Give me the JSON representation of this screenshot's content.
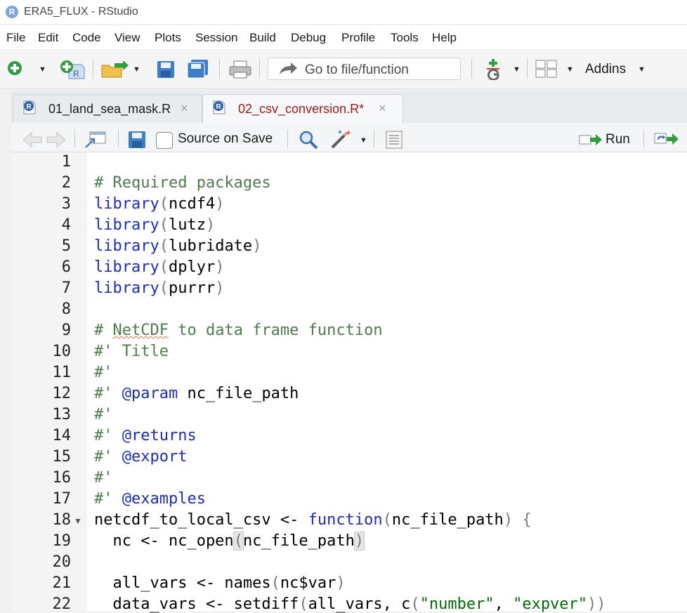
{
  "window": {
    "title": "ERA5_FLUX - RStudio",
    "logo_letter": "R"
  },
  "menu": [
    "File",
    "Edit",
    "Code",
    "View",
    "Plots",
    "Session",
    "Build",
    "Debug",
    "Profile",
    "Tools",
    "Help"
  ],
  "toolbar": {
    "goto_placeholder": "Go to file/function",
    "addins_label": "Addins"
  },
  "tabs": [
    {
      "label": "01_land_sea_mask.R",
      "active": false,
      "close": "×"
    },
    {
      "label": "02_csv_conversion.R*",
      "active": true,
      "close": "×"
    }
  ],
  "editor_toolbar": {
    "source_on_save_label": "Source on Save",
    "source_on_save_checked": false,
    "run_label": "Run"
  },
  "editor": {
    "line_numbers": [
      "1",
      "2",
      "3",
      "4",
      "5",
      "6",
      "7",
      "8",
      "9",
      "10",
      "11",
      "12",
      "13",
      "14",
      "15",
      "16",
      "17",
      "18",
      "19",
      "20",
      "21",
      "22"
    ],
    "lines": [
      "",
      "# Required packages",
      "library(ncdf4)",
      "library(lutz)",
      "library(lubridate)",
      "library(dplyr)",
      "library(purrr)",
      "",
      "# NetCDF to data frame function",
      "#' Title",
      "#'",
      "#' @param nc_file_path",
      "#'",
      "#' @returns",
      "#' @export",
      "#'",
      "#' @examples",
      "netcdf_to_local_csv <- function(nc_file_path) {",
      "  nc <- nc_open(nc_file_path)",
      "",
      "  all_vars <- names(nc$var)",
      "  data_vars <- setdiff(all_vars, c(\"number\", \"expver\"))"
    ]
  },
  "colors": {
    "comment": "#4d7c4d",
    "keyword": "#1c2ad0",
    "roxygen_tag": "#1a2eb8",
    "string": "#036a07",
    "active_tab_text": "#a01818"
  }
}
